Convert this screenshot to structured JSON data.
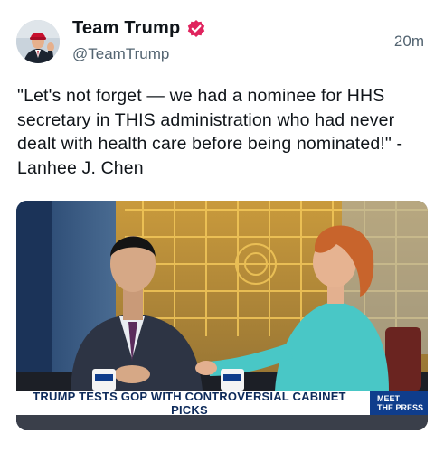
{
  "author": {
    "display_name": "Team Trump",
    "handle": "@TeamTrump",
    "verified": true,
    "verified_badge_color": "#e0245e"
  },
  "post": {
    "timestamp": "20m",
    "text": "\"Let's not forget — we had a nominee for HHS secretary in THIS administration who had never dealt with health care before being nominated!\" - Lanhee J. Chen"
  },
  "media": {
    "chyron_text": "TRUMP TESTS GOP WITH CONTROVERSIAL CABINET PICKS",
    "network_logo_line1": "MEET",
    "network_logo_line2": "THE PRESS",
    "mug_label": "MEET THE PRESS"
  }
}
